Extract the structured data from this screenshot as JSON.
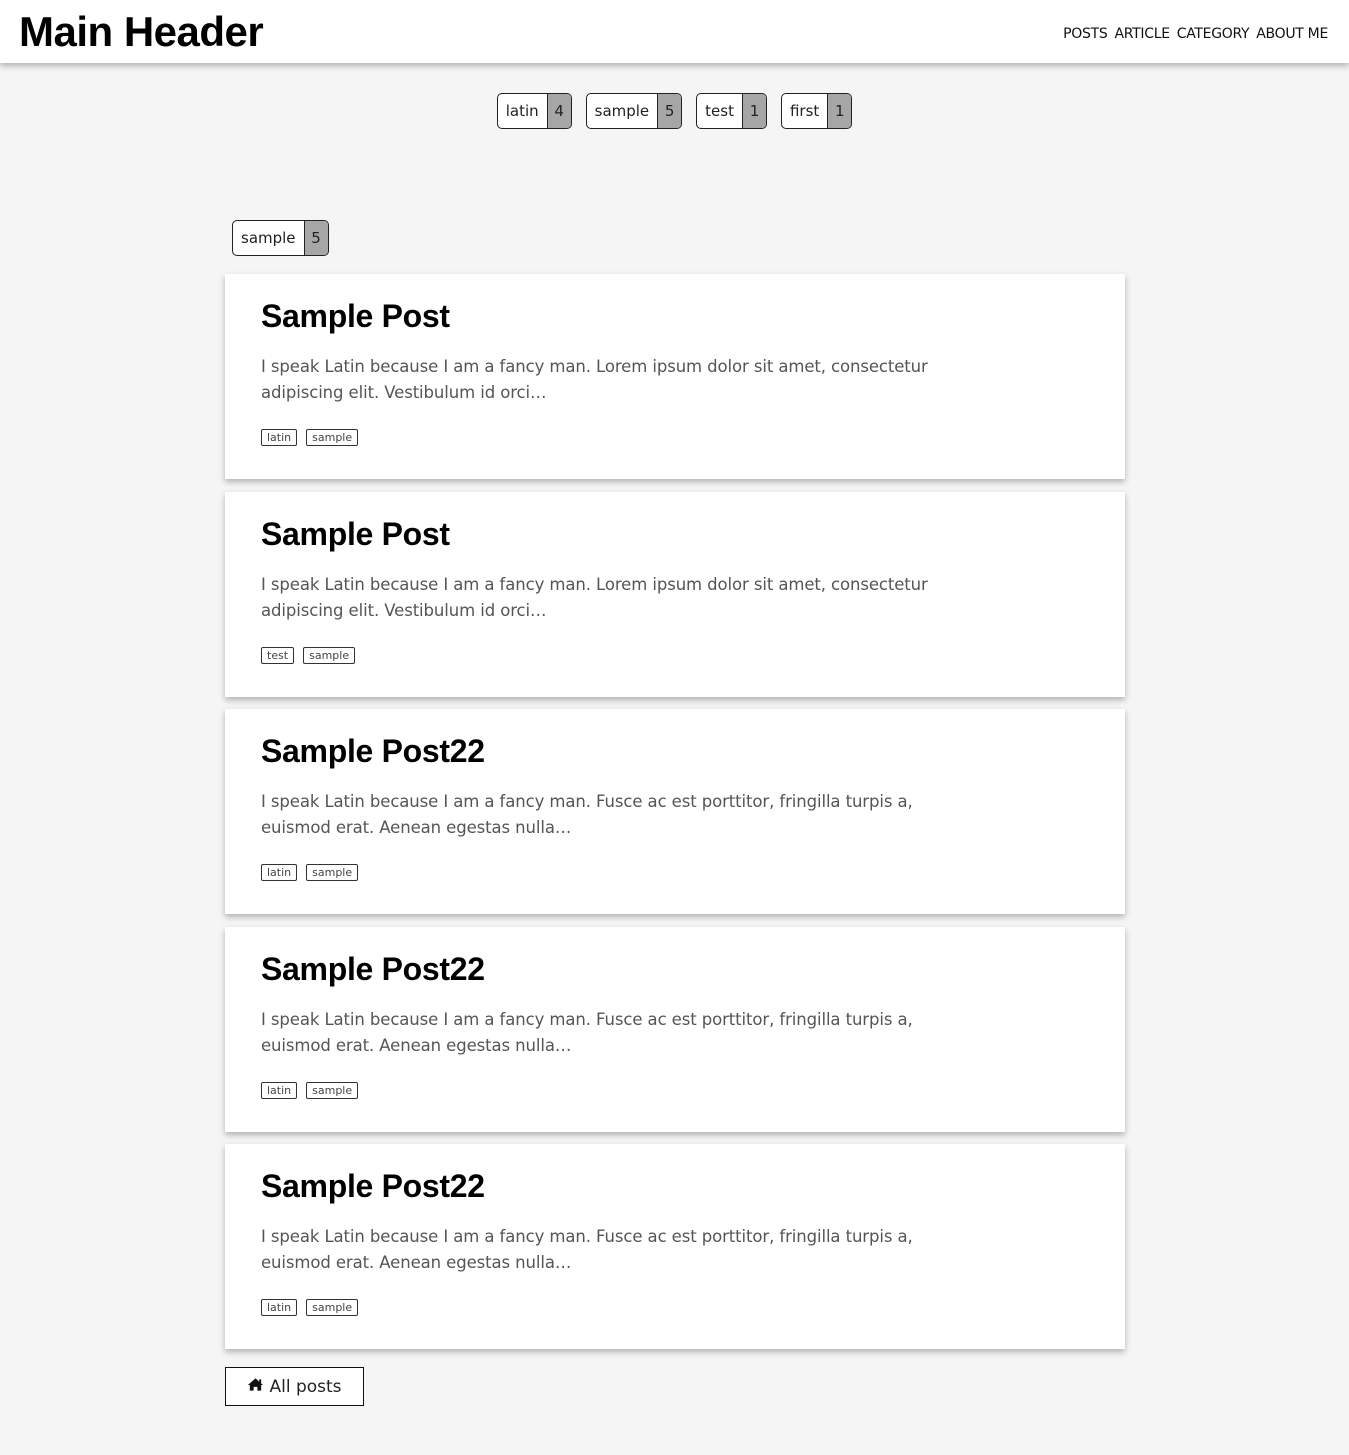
{
  "header": {
    "title": "Main Header",
    "nav": [
      "POSTS",
      "ARTICLE",
      "CATEGORY",
      "ABOUT ME"
    ]
  },
  "tag_cloud": [
    {
      "name": "latin",
      "count": "4"
    },
    {
      "name": "sample",
      "count": "5"
    },
    {
      "name": "test",
      "count": "1"
    },
    {
      "name": "first",
      "count": "1"
    }
  ],
  "current_tag": {
    "name": "sample",
    "count": "5"
  },
  "posts": [
    {
      "title": "Sample Post",
      "excerpt": "I speak Latin because I am a fancy man. Lorem ipsum dolor sit amet, consectetur adipiscing elit. Vestibulum id orci…",
      "tags": [
        "latin",
        "sample"
      ]
    },
    {
      "title": "Sample Post",
      "excerpt": "I speak Latin because I am a fancy man. Lorem ipsum dolor sit amet, consectetur adipiscing elit. Vestibulum id orci…",
      "tags": [
        "test",
        "sample"
      ]
    },
    {
      "title": "Sample Post22",
      "excerpt": "I speak Latin because I am a fancy man. Fusce ac est porttitor, fringilla turpis a, euismod erat. Aenean egestas nulla…",
      "tags": [
        "latin",
        "sample"
      ]
    },
    {
      "title": "Sample Post22",
      "excerpt": "I speak Latin because I am a fancy man. Fusce ac est porttitor, fringilla turpis a, euismod erat. Aenean egestas nulla…",
      "tags": [
        "latin",
        "sample"
      ]
    },
    {
      "title": "Sample Post22",
      "excerpt": "I speak Latin because I am a fancy man. Fusce ac est porttitor, fringilla turpis a, euismod erat. Aenean egestas nulla…",
      "tags": [
        "latin",
        "sample"
      ]
    }
  ],
  "all_posts_button": {
    "label": "All posts",
    "icon": "home-icon"
  }
}
